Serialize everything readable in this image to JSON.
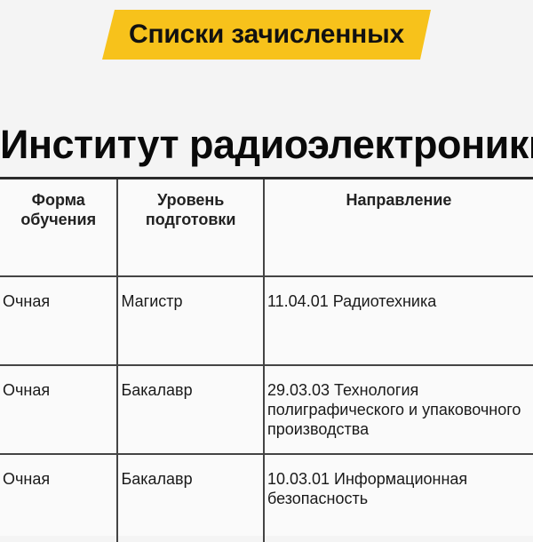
{
  "banner": {
    "text": "Списки зачисленных",
    "color": "#f7c21b"
  },
  "title": "Институт радиоэлектроники",
  "table": {
    "headers": [
      "Форма обучения",
      "Уровень подготовки",
      "Направление"
    ],
    "rows": [
      [
        "Очная",
        "Магистр",
        "11.04.01 Радиотехника"
      ],
      [
        "Очная",
        "Бакалавр",
        "29.03.03 Технология полиграфического и упаковочного производства"
      ],
      [
        "Очная",
        "Бакалавр",
        "10.03.01 Информационная безопасность"
      ]
    ]
  }
}
